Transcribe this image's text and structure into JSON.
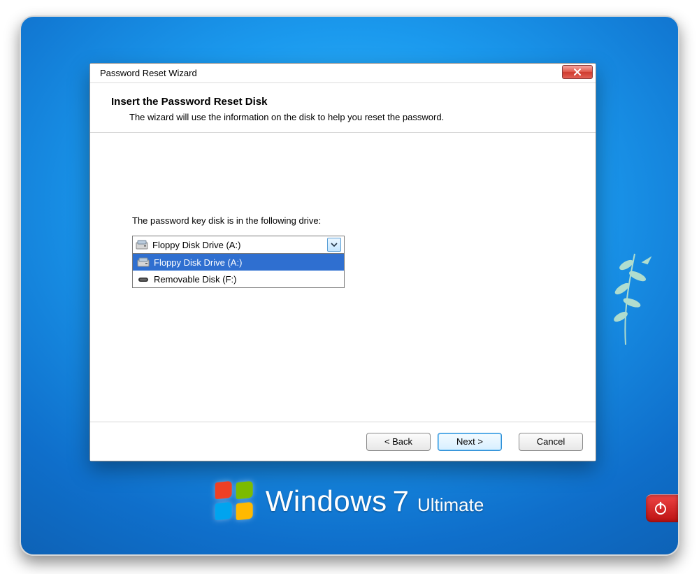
{
  "os": {
    "brand": "Windows",
    "version": "7",
    "edition": "Ultimate"
  },
  "window": {
    "title": "Password Reset Wizard",
    "close_icon": "close-icon"
  },
  "header": {
    "heading": "Insert the Password Reset Disk",
    "description": "The wizard will use the information on the disk to help you reset the password."
  },
  "body": {
    "prompt": "The password key disk is in the following drive:",
    "combo": {
      "selected": "Floppy Disk Drive (A:)",
      "options": [
        {
          "label": "Floppy Disk Drive (A:)",
          "icon": "floppy-drive",
          "highlighted": true
        },
        {
          "label": "Removable Disk (F:)",
          "icon": "removable-disk",
          "highlighted": false
        }
      ]
    }
  },
  "footer": {
    "back": "< Back",
    "next": "Next >",
    "cancel": "Cancel"
  }
}
